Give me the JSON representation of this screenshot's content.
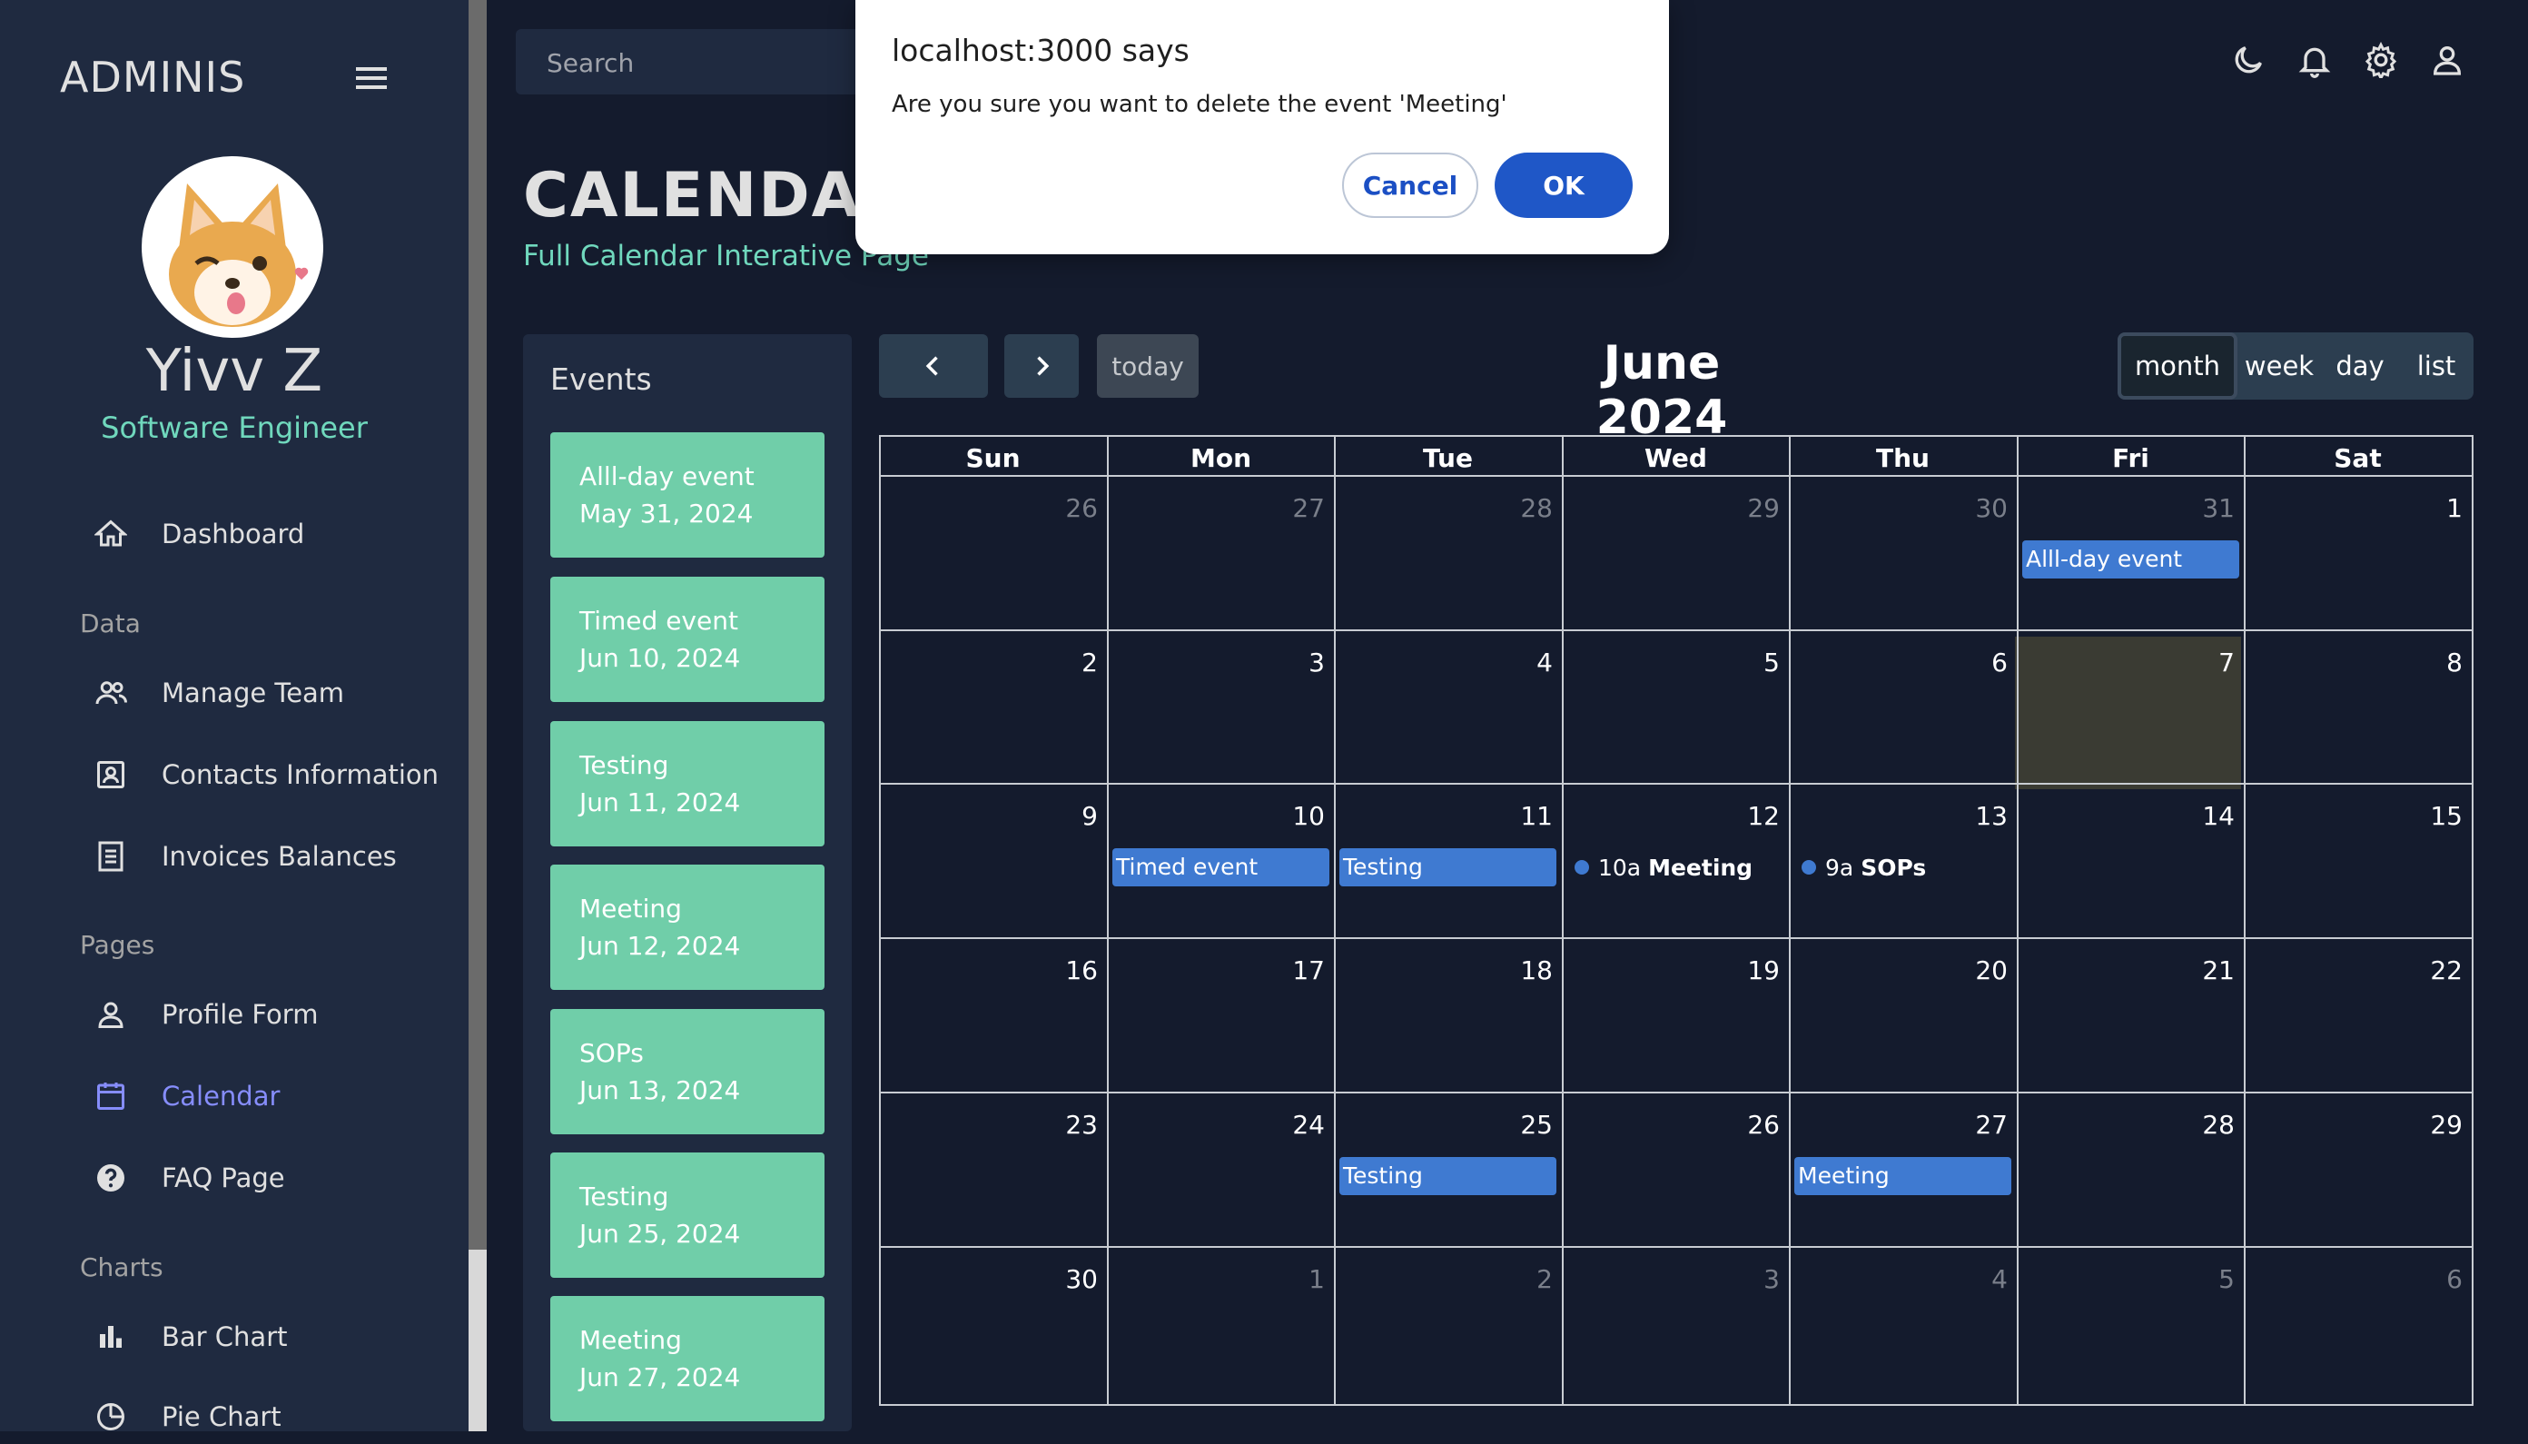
{
  "sidebar": {
    "brand": "ADMINIS",
    "user_name": "Yivv Z",
    "user_role": "Software Engineer",
    "items": [
      {
        "label": "Dashboard",
        "icon": "home-icon"
      },
      {
        "section": "Data"
      },
      {
        "label": "Manage Team",
        "icon": "people-icon"
      },
      {
        "label": "Contacts Information",
        "icon": "contacts-icon"
      },
      {
        "label": "Invoices Balances",
        "icon": "receipt-icon"
      },
      {
        "section": "Pages"
      },
      {
        "label": "Profile Form",
        "icon": "person-icon"
      },
      {
        "label": "Calendar",
        "icon": "calendar-icon",
        "active": true
      },
      {
        "label": "FAQ Page",
        "icon": "help-icon"
      },
      {
        "section": "Charts"
      },
      {
        "label": "Bar Chart",
        "icon": "bar-chart-icon"
      },
      {
        "label": "Pie Chart",
        "icon": "pie-chart-icon"
      }
    ],
    "active_color": "#868dfb",
    "accent_color": "#70d8bd"
  },
  "topbar": {
    "search_placeholder": "Search",
    "icons": [
      "dark-mode-icon",
      "notifications-icon",
      "settings-icon",
      "profile-icon"
    ]
  },
  "header": {
    "title": "CALENDAR",
    "subtitle": "Full Calendar Interative Page"
  },
  "events_panel": {
    "title": "Events",
    "events": [
      {
        "name": "Alll-day event",
        "date": "May 31, 2024"
      },
      {
        "name": "Timed event",
        "date": "Jun 10, 2024"
      },
      {
        "name": "Testing",
        "date": "Jun 11, 2024"
      },
      {
        "name": "Meeting",
        "date": "Jun 12, 2024"
      },
      {
        "name": "SOPs",
        "date": "Jun 13, 2024"
      },
      {
        "name": "Testing",
        "date": "Jun 25, 2024"
      },
      {
        "name": "Meeting",
        "date": "Jun 27, 2024"
      }
    ]
  },
  "calendar": {
    "title": "June 2024",
    "today_label": "today",
    "views": [
      "month",
      "week",
      "day",
      "list"
    ],
    "active_view": "month",
    "weekdays": [
      "Sun",
      "Mon",
      "Tue",
      "Wed",
      "Thu",
      "Fri",
      "Sat"
    ],
    "weeks": [
      [
        {
          "n": "26",
          "o": true
        },
        {
          "n": "27",
          "o": true
        },
        {
          "n": "28",
          "o": true
        },
        {
          "n": "29",
          "o": true
        },
        {
          "n": "30",
          "o": true
        },
        {
          "n": "31",
          "o": true
        },
        {
          "n": "1"
        }
      ],
      [
        {
          "n": "2"
        },
        {
          "n": "3"
        },
        {
          "n": "4"
        },
        {
          "n": "5"
        },
        {
          "n": "6"
        },
        {
          "n": "7"
        },
        {
          "n": "8"
        }
      ],
      [
        {
          "n": "9"
        },
        {
          "n": "10"
        },
        {
          "n": "11"
        },
        {
          "n": "12"
        },
        {
          "n": "13"
        },
        {
          "n": "14"
        },
        {
          "n": "15"
        }
      ],
      [
        {
          "n": "16"
        },
        {
          "n": "17"
        },
        {
          "n": "18"
        },
        {
          "n": "19"
        },
        {
          "n": "20"
        },
        {
          "n": "21"
        },
        {
          "n": "22"
        }
      ],
      [
        {
          "n": "23"
        },
        {
          "n": "24"
        },
        {
          "n": "25"
        },
        {
          "n": "26"
        },
        {
          "n": "27"
        },
        {
          "n": "28"
        },
        {
          "n": "29"
        }
      ],
      [
        {
          "n": "30"
        },
        {
          "n": "1",
          "o": true
        },
        {
          "n": "2",
          "o": true
        },
        {
          "n": "3",
          "o": true
        },
        {
          "n": "4",
          "o": true
        },
        {
          "n": "5",
          "o": true
        },
        {
          "n": "6",
          "o": true
        }
      ]
    ],
    "today": "7",
    "grid_events": [
      {
        "label": "Alll-day event",
        "week": 0,
        "day": 5,
        "kind": "bar"
      },
      {
        "label": "Timed event",
        "week": 2,
        "day": 1,
        "kind": "bar"
      },
      {
        "label": "Testing",
        "week": 2,
        "day": 2,
        "kind": "bar"
      },
      {
        "time": "10a",
        "label": "Meeting",
        "week": 2,
        "day": 3,
        "kind": "dot"
      },
      {
        "time": "9a",
        "label": "SOPs",
        "week": 2,
        "day": 4,
        "kind": "dot"
      },
      {
        "label": "Testing",
        "week": 4,
        "day": 2,
        "kind": "bar"
      },
      {
        "label": "Meeting",
        "week": 4,
        "day": 4,
        "kind": "bar"
      }
    ],
    "event_color": "#3f7ad1",
    "today_color": "#3a3b33"
  },
  "dialog": {
    "title": "localhost:3000 says",
    "message": "Are you sure you want to delete the event 'Meeting'",
    "cancel_label": "Cancel",
    "ok_label": "OK"
  }
}
